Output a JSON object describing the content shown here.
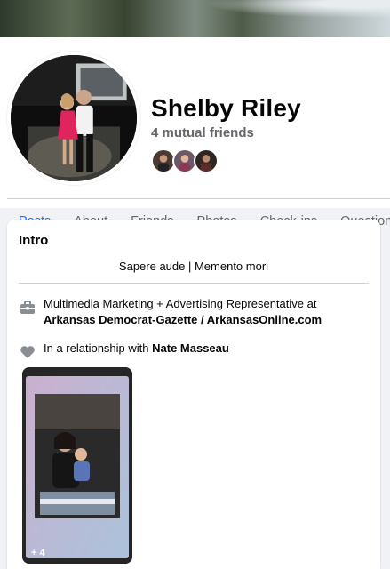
{
  "profile": {
    "name": "Shelby Riley",
    "mutual_friends": "4 mutual friends"
  },
  "tabs": [
    {
      "label": "Posts",
      "active": true
    },
    {
      "label": "About"
    },
    {
      "label": "Friends"
    },
    {
      "label": "Photos"
    },
    {
      "label": "Check-ins"
    },
    {
      "label": "Questions"
    }
  ],
  "intro": {
    "title": "Intro",
    "bio": "Sapere aude | Memento mori",
    "work": {
      "prefix": "Multimedia Marketing + Advertising Representative at ",
      "company": "Arkansas Democrat-Gazette / ArkansasOnline.com"
    },
    "relationship": {
      "prefix": "In a relationship with ",
      "partner": "Nate Masseau"
    },
    "photos_more": "+ 4"
  },
  "colors": {
    "accent": "#1877f2",
    "secondary_text": "#65676b"
  }
}
